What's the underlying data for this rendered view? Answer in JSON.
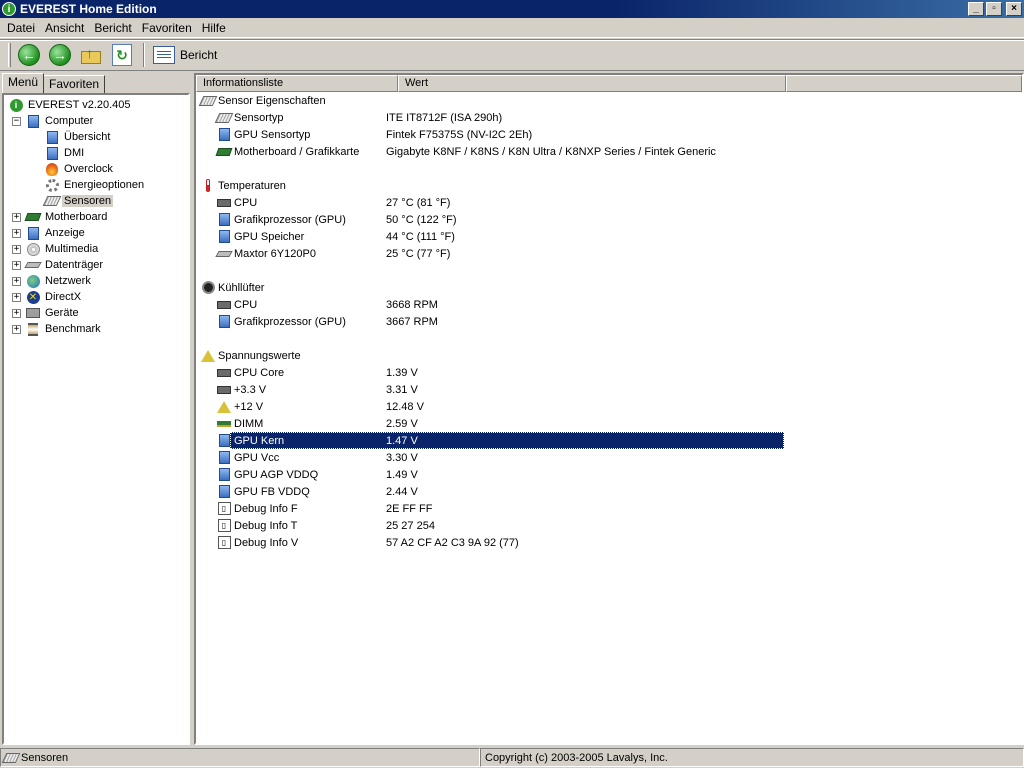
{
  "window": {
    "title": "EVEREST Home Edition",
    "app_icon": "info-icon",
    "buttons": {
      "minimize": "_",
      "maximize": "▫",
      "close": "×"
    }
  },
  "menu": [
    "Datei",
    "Ansicht",
    "Bericht",
    "Favoriten",
    "Hilfe"
  ],
  "toolbar": {
    "back_icon": "back-icon",
    "forward_icon": "forward-icon",
    "up_icon": "folder-up-icon",
    "refresh_icon": "refresh-icon",
    "report_label": "Bericht"
  },
  "left_panel": {
    "tabs": [
      "Menü",
      "Favoriten"
    ],
    "active_tab": "Menü",
    "tree": [
      {
        "label": "EVEREST v2.20.405",
        "level": 0,
        "expander": "",
        "icon": "info-icon"
      },
      {
        "label": "Computer",
        "level": 1,
        "expander": "−",
        "icon": "computer-icon"
      },
      {
        "label": "Übersicht",
        "level": 2,
        "expander": "",
        "icon": "computer-icon"
      },
      {
        "label": "DMI",
        "level": 2,
        "expander": "",
        "icon": "computer-icon"
      },
      {
        "label": "Overclock",
        "level": 2,
        "expander": "",
        "icon": "fire-icon"
      },
      {
        "label": "Energieoptionen",
        "level": 2,
        "expander": "",
        "icon": "gear-icon"
      },
      {
        "label": "Sensoren",
        "level": 2,
        "expander": "",
        "icon": "sensor-icon",
        "selected": true
      },
      {
        "label": "Motherboard",
        "level": 1,
        "expander": "+",
        "icon": "motherboard-icon"
      },
      {
        "label": "Anzeige",
        "level": 1,
        "expander": "+",
        "icon": "monitor-icon"
      },
      {
        "label": "Multimedia",
        "level": 1,
        "expander": "+",
        "icon": "multimedia-icon"
      },
      {
        "label": "Datenträger",
        "level": 1,
        "expander": "+",
        "icon": "disk-icon"
      },
      {
        "label": "Netzwerk",
        "level": 1,
        "expander": "+",
        "icon": "globe-icon"
      },
      {
        "label": "DirectX",
        "level": 1,
        "expander": "+",
        "icon": "directx-icon"
      },
      {
        "label": "Geräte",
        "level": 1,
        "expander": "+",
        "icon": "devices-icon"
      },
      {
        "label": "Benchmark",
        "level": 1,
        "expander": "+",
        "icon": "hourglass-icon"
      }
    ]
  },
  "list": {
    "columns": [
      "Informationsliste",
      "Wert"
    ],
    "groups": [
      {
        "title": "Sensor Eigenschaften",
        "icon": "sensor-icon",
        "items": [
          {
            "field": "Sensortyp",
            "value": "ITE IT8712F  (ISA 290h)",
            "icon": "sensor-icon"
          },
          {
            "field": "GPU Sensortyp",
            "value": "Fintek F75375S  (NV-I2C 2Eh)",
            "icon": "monitor-icon"
          },
          {
            "field": "Motherboard / Grafikkarte",
            "value": "Gigabyte K8NF / K8NS / K8N Ultra / K8NXP Series / Fintek Generic",
            "icon": "motherboard-icon"
          }
        ]
      },
      {
        "title": "Temperaturen",
        "icon": "thermometer-icon",
        "items": [
          {
            "field": "CPU",
            "value": "27 °C  (81 °F)",
            "icon": "cpu-icon"
          },
          {
            "field": "Grafikprozessor (GPU)",
            "value": "50 °C  (122 °F)",
            "icon": "monitor-icon"
          },
          {
            "field": "GPU Speicher",
            "value": "44 °C  (111 °F)",
            "icon": "monitor-icon"
          },
          {
            "field": "Maxtor 6Y120P0",
            "value": "25 °C  (77 °F)",
            "icon": "disk-icon"
          }
        ]
      },
      {
        "title": "Kühllüfter",
        "icon": "fan-icon",
        "items": [
          {
            "field": "CPU",
            "value": "3668 RPM",
            "icon": "cpu-icon"
          },
          {
            "field": "Grafikprozessor (GPU)",
            "value": "3667 RPM",
            "icon": "monitor-icon"
          }
        ]
      },
      {
        "title": "Spannungswerte",
        "icon": "voltage-icon",
        "items": [
          {
            "field": "CPU Core",
            "value": "1.39 V",
            "icon": "cpu-icon"
          },
          {
            "field": "+3.3 V",
            "value": "3.31 V",
            "icon": "cpu-icon"
          },
          {
            "field": "+12 V",
            "value": "12.48 V",
            "icon": "voltage-icon"
          },
          {
            "field": "DIMM",
            "value": "2.59 V",
            "icon": "ram-icon"
          },
          {
            "field": "GPU Kern",
            "value": "1.47 V",
            "icon": "monitor-icon",
            "selected": true
          },
          {
            "field": "GPU Vcc",
            "value": "3.30 V",
            "icon": "monitor-icon"
          },
          {
            "field": "GPU AGP VDDQ",
            "value": "1.49 V",
            "icon": "monitor-icon"
          },
          {
            "field": "GPU FB VDDQ",
            "value": "2.44 V",
            "icon": "monitor-icon"
          },
          {
            "field": "Debug Info F",
            "value": "2E FF FF",
            "icon": "debug-icon"
          },
          {
            "field": "Debug Info T",
            "value": "25 27 254",
            "icon": "debug-icon"
          },
          {
            "field": "Debug Info V",
            "value": "57 A2 CF A2 C3 9A 92 (77)",
            "icon": "debug-icon"
          }
        ]
      }
    ]
  },
  "statusbar": {
    "left": "Sensoren",
    "right": "Copyright (c) 2003-2005 Lavalys, Inc."
  },
  "colors": {
    "titlebar": "#0a246a",
    "selection": "#0a246a",
    "face": "#d4d0c8"
  }
}
